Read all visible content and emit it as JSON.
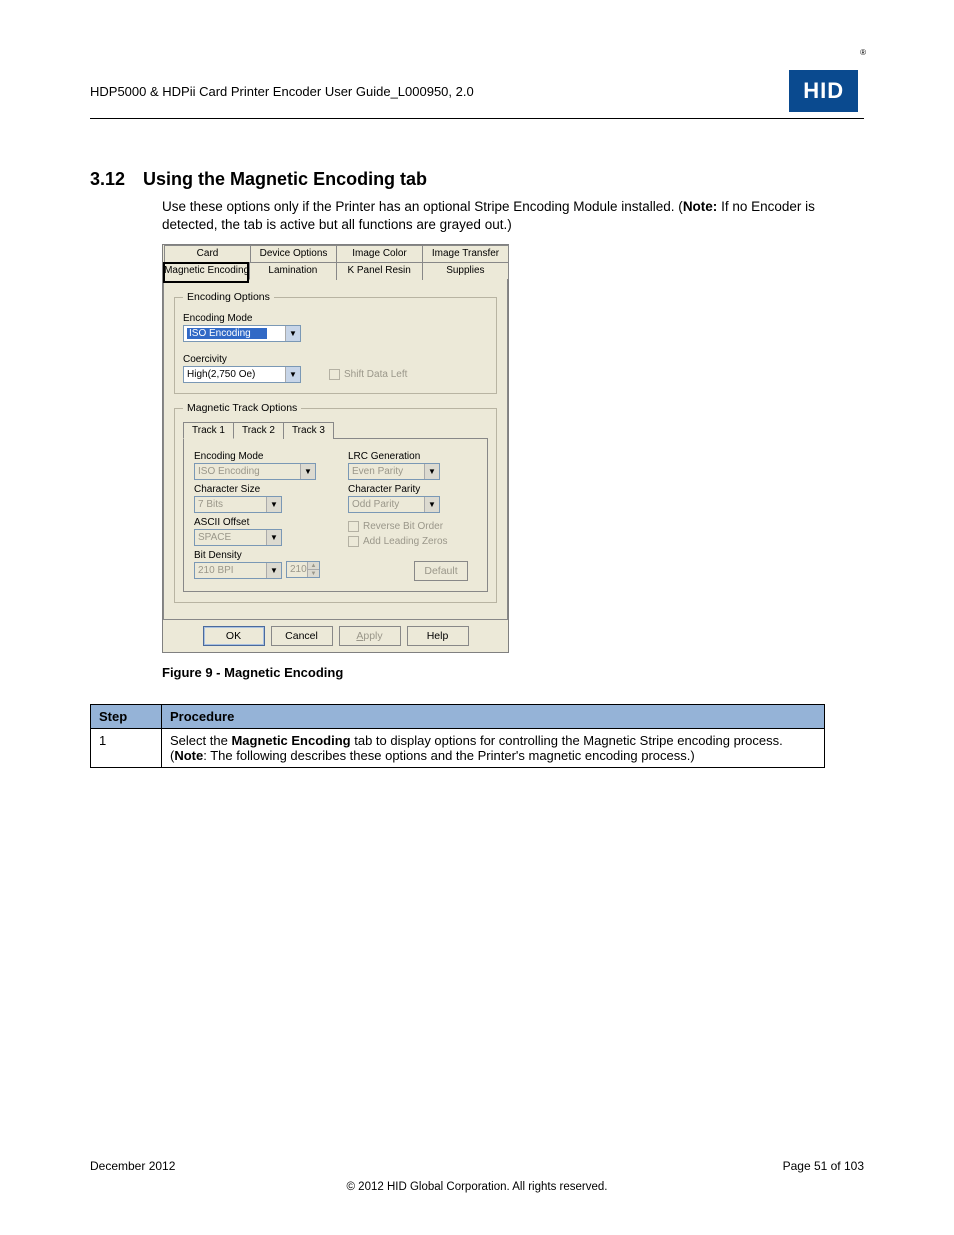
{
  "header": {
    "doc_title": "HDP5000 & HDPii Card Printer Encoder User Guide_L000950, 2.0",
    "logo_text": "HID"
  },
  "section": {
    "num": "3.12",
    "title": "Using the Magnetic Encoding tab",
    "body_pre": "Use these options only if the Printer has an optional   Stripe Encoding Module installed. (",
    "note_label": "Note:",
    "body_post": "  If no Encoder is detected, the tab is active but all functions are grayed out.)"
  },
  "dialog": {
    "tabs_row1": [
      "Card",
      "Device Options",
      "Image Color",
      "Image Transfer"
    ],
    "tabs_row2": [
      "Magnetic Encoding",
      "Lamination",
      "K Panel Resin",
      "Supplies"
    ],
    "encoding_options": {
      "legend": "Encoding Options",
      "encoding_mode_label": "Encoding Mode",
      "encoding_mode_value": "ISO Encoding",
      "coercivity_label": "Coercivity",
      "coercivity_value": "High(2,750 Oe)",
      "shift_left_label": "Shift Data Left"
    },
    "magnetic_track": {
      "legend": "Magnetic Track Options",
      "tracks": [
        "Track 1",
        "Track 2",
        "Track 3"
      ],
      "encoding_mode_label": "Encoding Mode",
      "encoding_mode_value": "ISO Encoding",
      "character_size_label": "Character Size",
      "character_size_value": "7 Bits",
      "ascii_offset_label": "ASCII Offset",
      "ascii_offset_value": "SPACE",
      "bit_density_label": "Bit Density",
      "bit_density_value": "210 BPI",
      "bit_density_spin": "210",
      "lrc_label": "LRC Generation",
      "lrc_value": "Even Parity",
      "char_parity_label": "Character Parity",
      "char_parity_value": "Odd Parity",
      "reverse_bit_label": "Reverse Bit Order",
      "leading_zero_label": "Add Leading Zeros",
      "default_btn": "Default"
    },
    "buttons": {
      "ok": "OK",
      "cancel": "Cancel",
      "apply": "Apply",
      "help": "Help"
    }
  },
  "figure_caption": "Figure 9 - Magnetic Encoding",
  "table": {
    "headers": {
      "step": "Step",
      "procedure": "Procedure"
    },
    "row1": {
      "step": "1",
      "proc_pre": "Select the ",
      "proc_bold": "Magnetic Encoding",
      "proc_mid": " tab to display options for controlling the Magnetic Stripe encoding process. (",
      "proc_note": "Note",
      "proc_post": ":  The following describes these options and the Printer's magnetic encoding process.)"
    }
  },
  "footer": {
    "left": "December 2012",
    "right": "Page 51 of 103",
    "center": "© 2012 HID Global Corporation. All rights reserved."
  }
}
